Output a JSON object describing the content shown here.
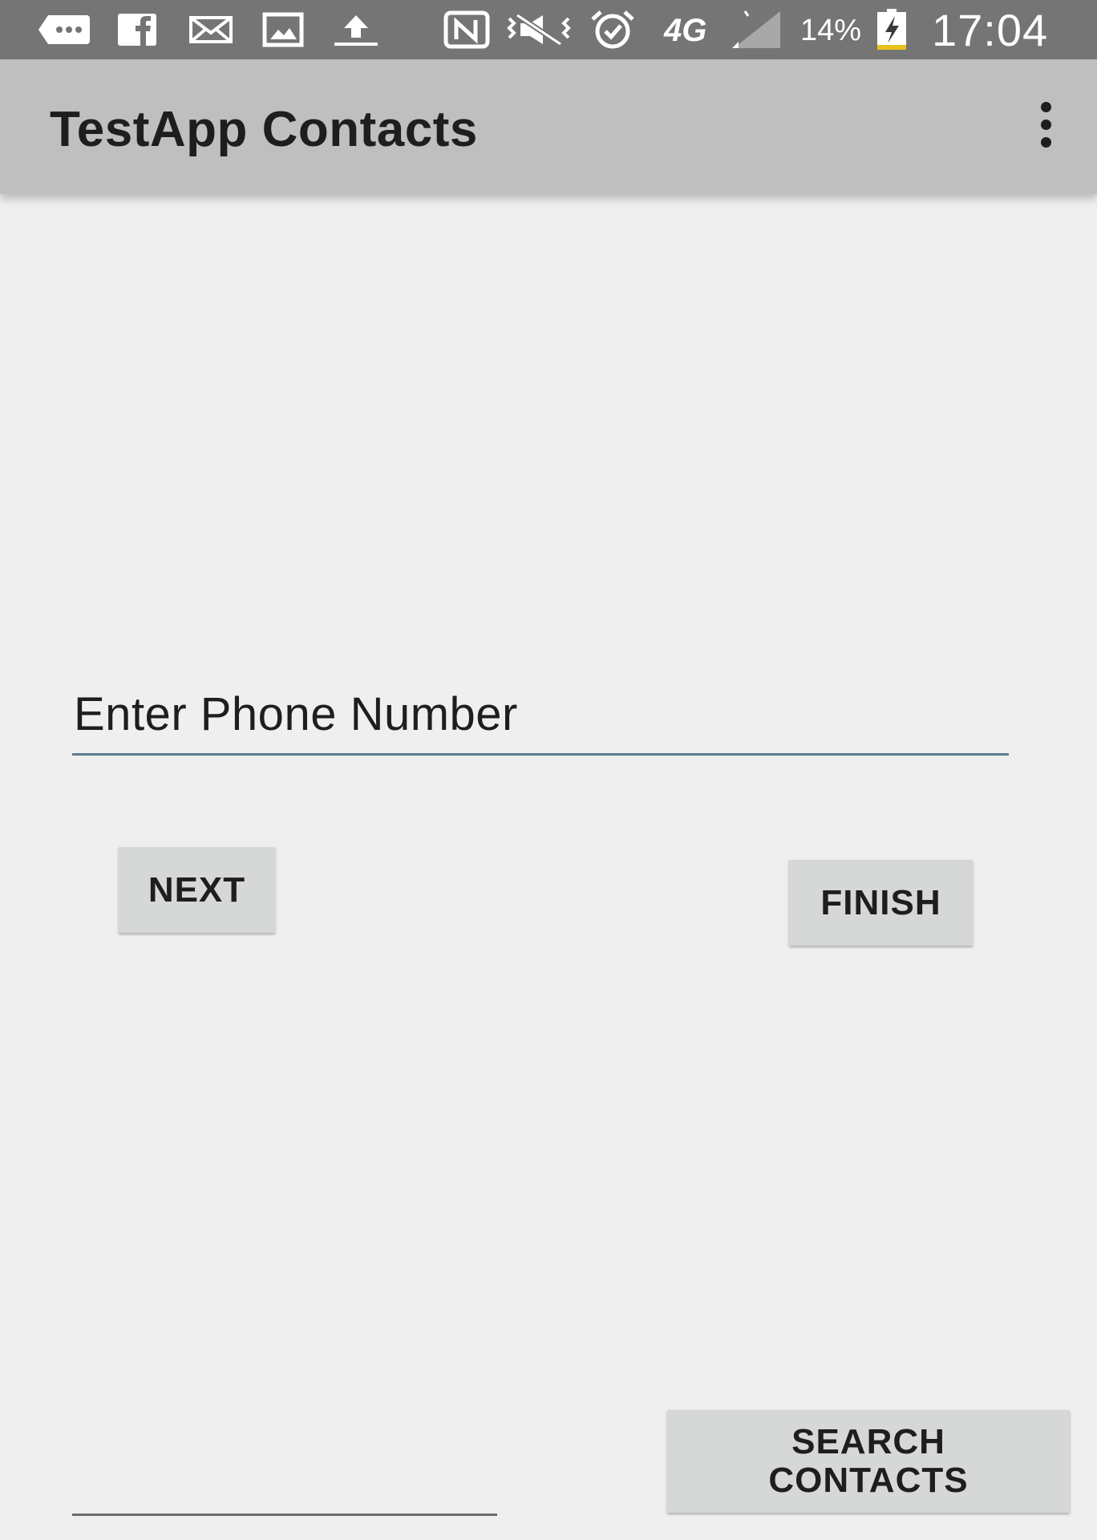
{
  "status_bar": {
    "icons": [
      "chat-bubble-icon",
      "facebook-icon",
      "mail-icon",
      "image-icon",
      "upload-icon",
      "nfc-icon",
      "vibrate-mute-icon",
      "alarm-icon",
      "network-4g-icon",
      "signal-icon",
      "battery-charging-icon"
    ],
    "network_type": "4G",
    "battery_percent": "14%",
    "time": "17:04"
  },
  "app_bar": {
    "title": "TestApp Contacts",
    "menu_icon": "more-vert-icon"
  },
  "form": {
    "phone_placeholder": "Enter Phone Number",
    "phone_value": "",
    "bottom_field_value": ""
  },
  "buttons": {
    "next": "NEXT",
    "finish": "FINISH",
    "search_line1": "SEARCH",
    "search_line2": "CONTACTS"
  },
  "colors": {
    "status_bar": "#757575",
    "app_bar": "#bfbfbf",
    "background": "#efefef",
    "button": "#d6d7d7",
    "input_underline": "#5a7d8c",
    "battery_accent": "#e8c21a"
  }
}
